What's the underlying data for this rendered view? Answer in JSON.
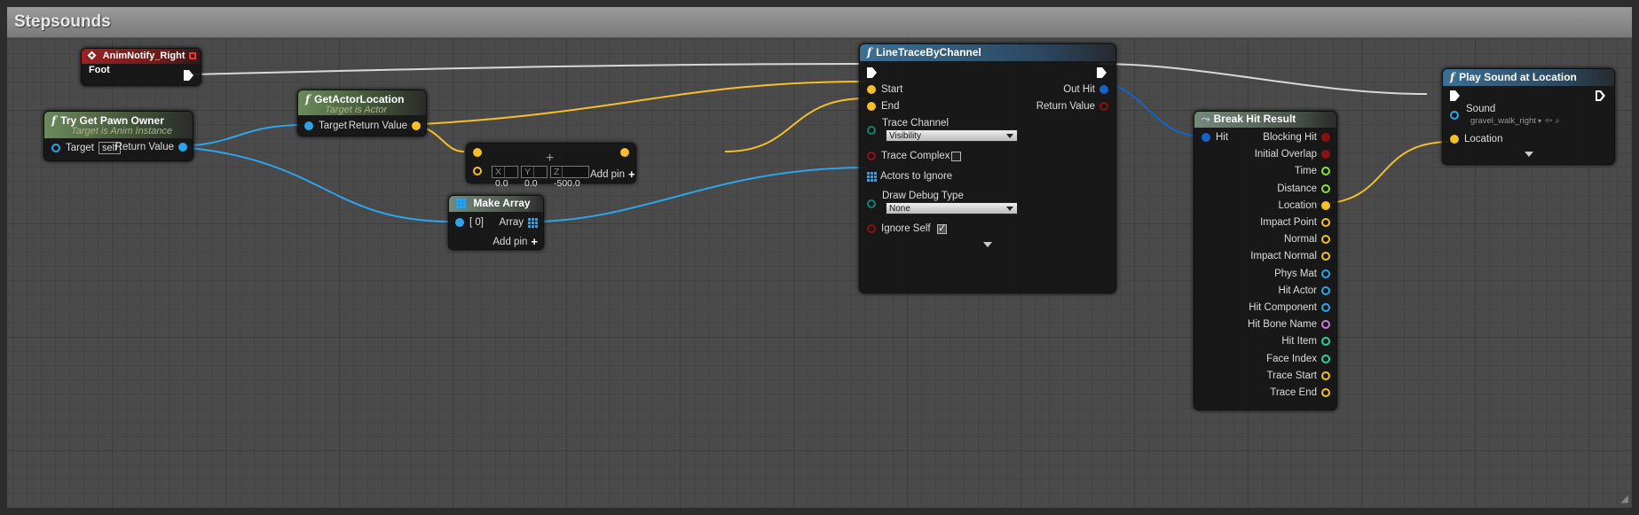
{
  "graph": {
    "title": "Stepsounds"
  },
  "nodes": {
    "anim_notify": {
      "title": "AnimNotify_Right Foot"
    },
    "try_get_pawn": {
      "title": "Try Get Pawn Owner",
      "subtitle": "Target is Anim Instance",
      "target_label": "Target",
      "target_default": "self",
      "return_label": "Return Value"
    },
    "get_actor_location": {
      "title": "GetActorLocation",
      "subtitle": "Target is Actor",
      "target_label": "Target",
      "return_label": "Return Value"
    },
    "add_vector": {
      "x_label": "X",
      "x_value": "0.0",
      "y_label": "Y",
      "y_value": "0.0",
      "z_label": "Z",
      "z_value": "-500.0",
      "add_pin_label": "Add pin"
    },
    "make_array": {
      "title": "Make Array",
      "index_label": "[ 0]",
      "array_label": "Array",
      "add_pin_label": "Add pin"
    },
    "line_trace": {
      "title": "LineTraceByChannel",
      "start_label": "Start",
      "end_label": "End",
      "trace_channel_label": "Trace Channel",
      "trace_channel_value": "Visibility",
      "trace_complex_label": "Trace Complex",
      "actors_to_ignore_label": "Actors to Ignore",
      "draw_debug_label": "Draw Debug Type",
      "draw_debug_value": "None",
      "ignore_self_label": "Ignore Self",
      "out_hit_label": "Out Hit",
      "return_label": "Return Value"
    },
    "break_hit": {
      "title": "Break Hit Result",
      "hit_label": "Hit",
      "outputs": [
        "Blocking Hit",
        "Initial Overlap",
        "Time",
        "Distance",
        "Location",
        "Impact Point",
        "Normal",
        "Impact Normal",
        "Phys Mat",
        "Hit Actor",
        "Hit Component",
        "Hit Bone Name",
        "Hit Item",
        "Face Index",
        "Trace Start",
        "Trace End"
      ]
    },
    "play_sound": {
      "title": "Play Sound at Location",
      "sound_label": "Sound",
      "sound_value": "gravel_walk_right",
      "location_label": "Location"
    }
  },
  "colors": {
    "exec": "#ffffff",
    "object": "#2ea3ea",
    "vector": "#f5bf2a",
    "bool": "#8b1111",
    "float": "#8ee03a",
    "name": "#c77ee3",
    "struct": "#1264c8",
    "byte": "#1a7f6c",
    "int": "#2ad2a0"
  },
  "icons": {
    "function": "function-icon",
    "event": "event-diamond-icon",
    "break": "break-struct-icon",
    "array": "array-grid-icon",
    "add": "plus-icon",
    "dropdown": "chevron-down-icon",
    "expand": "expand-arrow-icon"
  }
}
